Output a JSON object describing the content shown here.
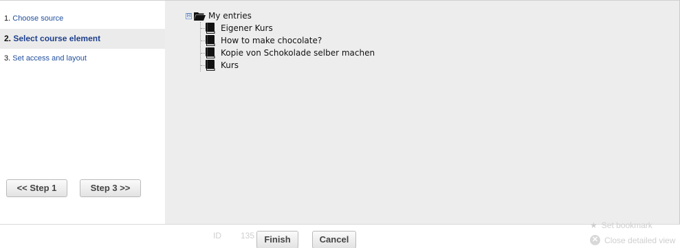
{
  "wizard": {
    "steps": [
      {
        "num": "1.",
        "label": "Choose source"
      },
      {
        "num": "2.",
        "label": "Select course element"
      },
      {
        "num": "3.",
        "label": "Set access and layout"
      }
    ],
    "active_step": 2,
    "prev_button": "<< Step 1",
    "next_button": "Step 3 >>"
  },
  "tree": {
    "toggle": "⊟",
    "root_label": "My entries",
    "items": [
      {
        "label": "Eigener Kurs",
        "icon": "book-icon"
      },
      {
        "label": "How to make chocolate?",
        "icon": "book-icon"
      },
      {
        "label": "Kopie von Schokolade selber machen",
        "icon": "book-icon"
      },
      {
        "label": "Kurs",
        "icon": "book-icon"
      }
    ]
  },
  "footer": {
    "finish_button": "Finish",
    "cancel_button": "Cancel",
    "background_id_label": "ID",
    "background_id_value": "135",
    "background_bookmark": "Set bookmark",
    "background_close": "Close detailed view",
    "close_glyph": "✕",
    "star_glyph": "★"
  },
  "colors": {
    "link": "#1f4e9c",
    "panel_bg": "#ededed",
    "active_step_bg": "#ebebeb"
  }
}
